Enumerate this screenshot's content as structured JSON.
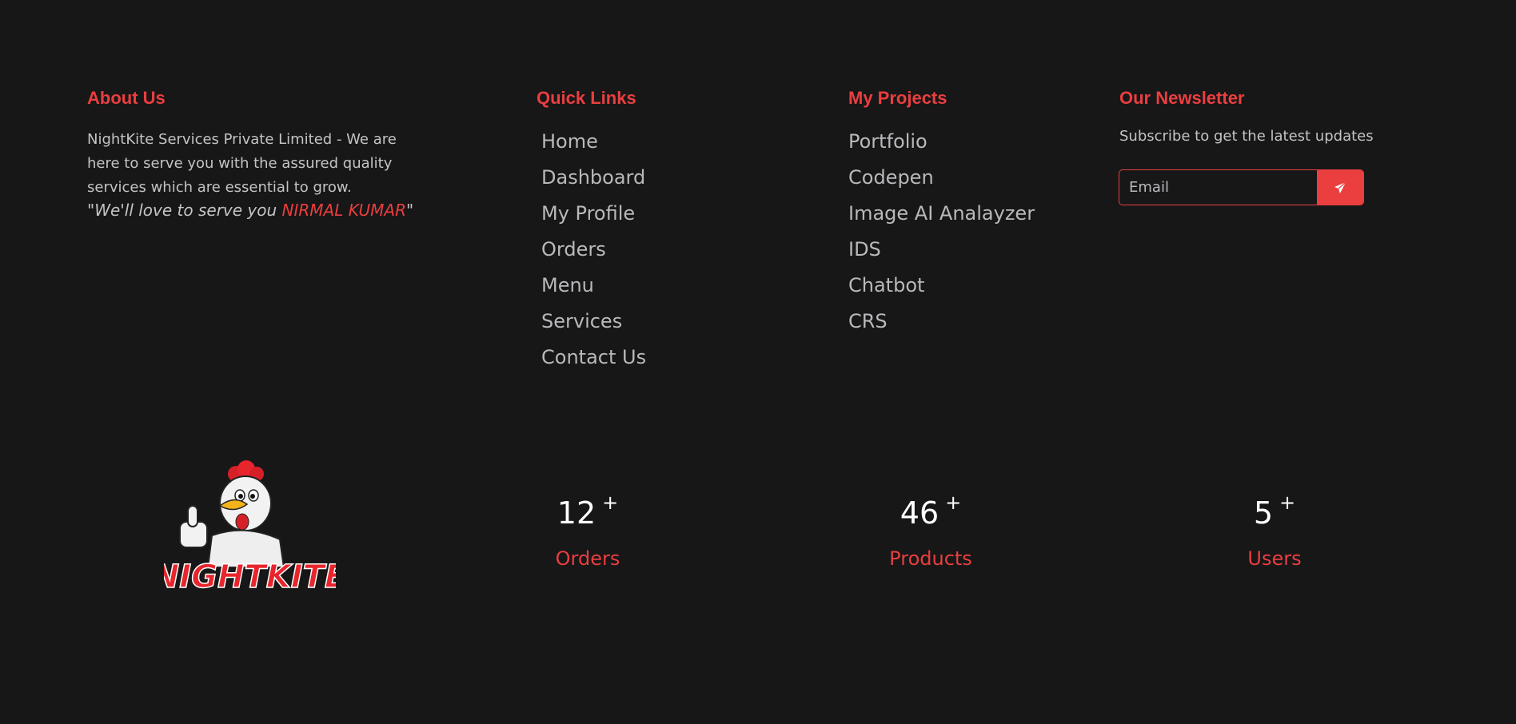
{
  "about": {
    "heading": "About Us",
    "text": "NightKite Services Private Limited - We are here to serve you with the assured quality services which are essential to grow.",
    "quote_prefix": "\"We'll love to serve you ",
    "quote_name": "NIRMAL KUMAR",
    "quote_suffix": "\""
  },
  "quick_links": {
    "heading": "Quick Links",
    "items": [
      "Home",
      "Dashboard",
      "My Profile",
      "Orders",
      "Menu",
      "Services",
      "Contact Us"
    ]
  },
  "projects": {
    "heading": "My Projects",
    "items": [
      "Portfolio",
      "Codepen",
      "Image AI Analayzer",
      "IDS",
      "Chatbot",
      "CRS"
    ]
  },
  "newsletter": {
    "heading": "Our Newsletter",
    "subtitle": "Subscribe to get the latest updates",
    "email_placeholder": "Email",
    "email_value": "",
    "send_icon": "paper-plane-icon"
  },
  "logo": {
    "text": "NIGHTKITE",
    "alt": "NightKite"
  },
  "stats": [
    {
      "number": "12",
      "suffix": "+",
      "label": "Orders"
    },
    {
      "number": "46",
      "suffix": "+",
      "label": "Products"
    },
    {
      "number": "5",
      "suffix": "+",
      "label": "Users"
    }
  ],
  "colors": {
    "background": "#171718",
    "accent": "#ea3e3f",
    "text": "#c4c4c4",
    "link": "#b9b9bc",
    "stat_number": "#ffffff"
  }
}
